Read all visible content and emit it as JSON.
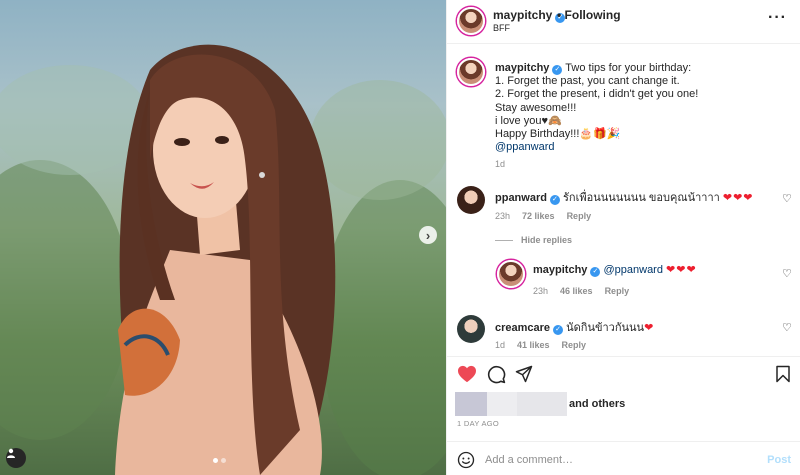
{
  "header": {
    "username": "maypitchy",
    "separator": "•",
    "follow_label": "Following",
    "subtitle": "BFF",
    "more_icon": "more-options-icon"
  },
  "caption": {
    "username": "maypitchy",
    "lines": [
      "Two tips for your birthday:",
      "1. Forget the past, you cant change it.",
      "2. Forget the present, i didn't get you one!",
      "Stay awesome!!!",
      "i love you♥🙈",
      "Happy Birthday!!!🎂🎁🎉"
    ],
    "mention": "@ppanward",
    "time": "1d"
  },
  "comments": [
    {
      "username": "ppanward",
      "text": "รักเพื่อนนนนนนน ขอบคุณน้าาาา",
      "hearts": "❤❤❤",
      "time": "23h",
      "likes": "72 likes",
      "reply_label": "Reply"
    },
    {
      "username": "maypitchy",
      "mention": "@ppanward",
      "hearts": "❤❤❤",
      "time": "23h",
      "likes": "46 likes",
      "reply_label": "Reply"
    },
    {
      "username": "creamcare",
      "text": "นัดกินข้าวกันนน",
      "hearts": "❤",
      "time": "1d",
      "likes": "41 likes",
      "reply_label": "Reply"
    }
  ],
  "hide_replies_label": "Hide replies",
  "likes": {
    "and_others": "and others"
  },
  "date_label": "1 DAY AGO",
  "add_comment": {
    "placeholder": "Add a comment…",
    "post_label": "Post"
  },
  "colors": {
    "link": "#00376b",
    "verified": "#3897f0",
    "heart": "#ed1f2f",
    "muted": "#8e8e8e",
    "post_disabled": "#b2dffc"
  }
}
